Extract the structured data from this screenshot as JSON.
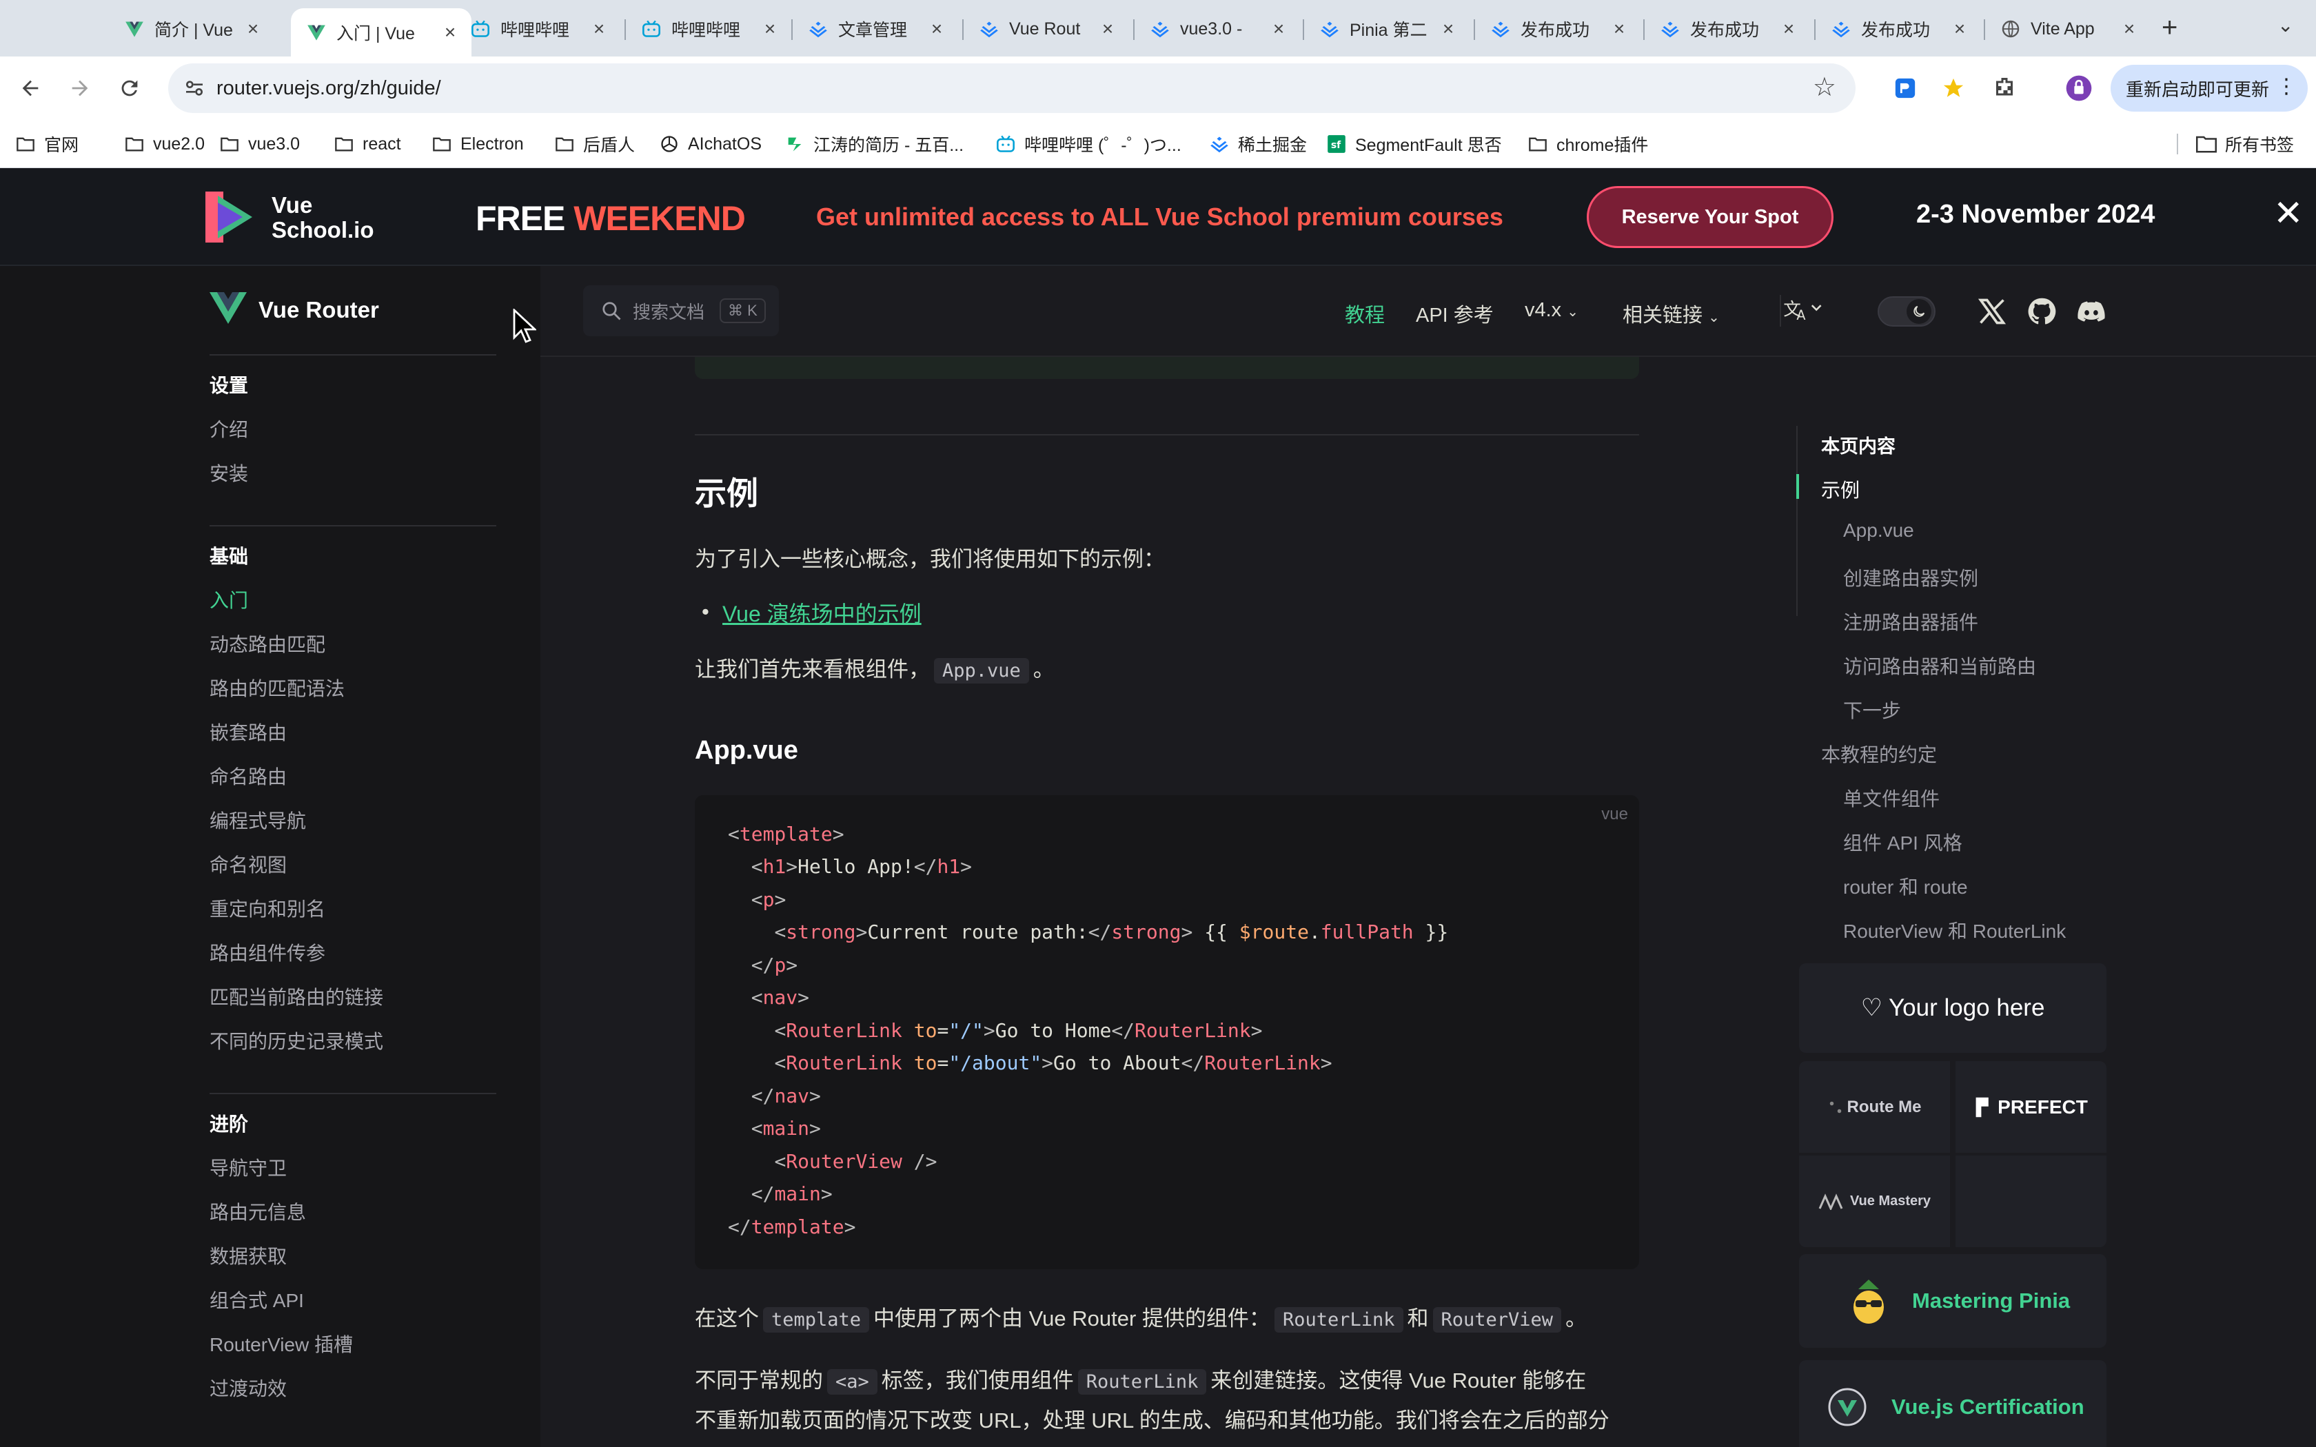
{
  "browser": {
    "tabs": [
      {
        "title": "简介 | Vue",
        "icon": "vue-logo",
        "active": false
      },
      {
        "title": "入门 | Vue",
        "icon": "vue-logo",
        "active": true
      },
      {
        "title": "哔哩哔哩",
        "icon": "bilibili-icon",
        "active": false
      },
      {
        "title": "哔哩哔哩",
        "icon": "bilibili-icon",
        "active": false
      },
      {
        "title": "文章管理",
        "icon": "juejin-icon",
        "active": false
      },
      {
        "title": "Vue Rout",
        "icon": "juejin-icon",
        "active": false
      },
      {
        "title": "vue3.0 -",
        "icon": "juejin-icon",
        "active": false
      },
      {
        "title": "Pinia 第二",
        "icon": "juejin-icon",
        "active": false
      },
      {
        "title": "发布成功",
        "icon": "juejin-icon",
        "active": false
      },
      {
        "title": "发布成功",
        "icon": "juejin-icon",
        "active": false
      },
      {
        "title": "发布成功",
        "icon": "juejin-icon",
        "active": false
      },
      {
        "title": "Vite App",
        "icon": "globe-icon",
        "active": false
      }
    ],
    "url": "router.vuejs.org/zh/guide/",
    "update_label": "重新启动即可更新",
    "bookmarks": [
      {
        "label": "官网",
        "icon": "folder-icon"
      },
      {
        "label": "vue2.0",
        "icon": "folder-icon"
      },
      {
        "label": "vue3.0",
        "icon": "folder-icon"
      },
      {
        "label": "react",
        "icon": "folder-icon"
      },
      {
        "label": "Electron",
        "icon": "folder-icon"
      },
      {
        "label": "后盾人",
        "icon": "folder-icon"
      },
      {
        "label": "AIchatOS",
        "icon": "openai-icon"
      },
      {
        "label": "江涛的简历 - 五百...",
        "icon": "resume-icon"
      },
      {
        "label": "哔哩哔哩 (゜-゜)つ...",
        "icon": "bilibili-icon"
      },
      {
        "label": "稀土掘金",
        "icon": "juejin-icon"
      },
      {
        "label": "SegmentFault 思否",
        "icon": "segmentfault-icon"
      },
      {
        "label": "chrome插件",
        "icon": "folder-icon"
      }
    ],
    "all_bookmarks": "所有书签"
  },
  "banner": {
    "logo_line1": "Vue",
    "logo_line2": "School.io",
    "free": "FREE",
    "weekend": "WEEKEND",
    "promo": "Get unlimited access to ALL Vue School premium courses",
    "cta": "Reserve Your Spot",
    "dates": "2-3 November 2024",
    "colors": {
      "accent": "#ff5a4e",
      "cta_border": "#ff4e6e"
    }
  },
  "site": {
    "name": "Vue Router",
    "search_placeholder": "搜索文档",
    "search_kbd": "⌘ K",
    "nav": {
      "guide": "教程",
      "api": "API 参考",
      "version": "v4.x",
      "links": "相关链接"
    },
    "accent": "#42d392"
  },
  "sidebar": {
    "sections": [
      {
        "title": "设置",
        "items": [
          "介绍",
          "安装"
        ]
      },
      {
        "title": "基础",
        "items": [
          "入门",
          "动态路由匹配",
          "路由的匹配语法",
          "嵌套路由",
          "命名路由",
          "编程式导航",
          "命名视图",
          "重定向和别名",
          "路由组件传参",
          "匹配当前路由的链接",
          "不同的历史记录模式"
        ]
      },
      {
        "title": "进阶",
        "items": [
          "导航守卫",
          "路由元信息",
          "数据获取",
          "组合式 API",
          "RouterView 插槽",
          "过渡动效"
        ]
      }
    ],
    "active_item": "入门"
  },
  "content": {
    "h2": "示例",
    "intro": "为了引入一些核心概念，我们将使用如下的示例：",
    "link": "Vue 演练场中的示例",
    "root_pre": "让我们首先来看根组件，",
    "root_code": "App.vue",
    "root_post": "。",
    "h3": "App.vue",
    "code_lang": "vue",
    "p2_a": "在这个",
    "p2_code1": "template",
    "p2_b": "中使用了两个由 Vue Router 提供的组件：",
    "p2_code2": "RouterLink",
    "p2_c": "和",
    "p2_code3": "RouterView",
    "p2_d": "。",
    "p3_a": "不同于常规的",
    "p3_code1": "<a>",
    "p3_b": "标签，我们使用组件",
    "p3_code2": "RouterLink",
    "p3_c": "来创建链接。这使得 Vue Router 能够在",
    "p4": "不重新加载页面的情况下改变 URL，处理 URL 的生成、编码和其他功能。我们将会在之后的部分"
  },
  "toc": {
    "title": "本页内容",
    "items": [
      {
        "label": "示例",
        "level": 1,
        "active": true
      },
      {
        "label": "App.vue",
        "level": 2
      },
      {
        "label": "创建路由器实例",
        "level": 2
      },
      {
        "label": "注册路由器插件",
        "level": 2
      },
      {
        "label": "访问路由器和当前路由",
        "level": 2
      },
      {
        "label": "下一步",
        "level": 2
      },
      {
        "label": "本教程的约定",
        "level": 1
      },
      {
        "label": "单文件组件",
        "level": 2
      },
      {
        "label": "组件 API 风格",
        "level": 2
      },
      {
        "label": "router 和 route",
        "level": 2
      },
      {
        "label": "RouterView 和 RouterLink",
        "level": 2
      }
    ]
  },
  "sponsors": {
    "logo_here": "♡ Your logo here",
    "cells": [
      "Route Me",
      "PREFECT",
      "Vue Mastery",
      ""
    ],
    "mastering_pinia": "Mastering Pinia",
    "certification": "Vue.js Certification"
  }
}
